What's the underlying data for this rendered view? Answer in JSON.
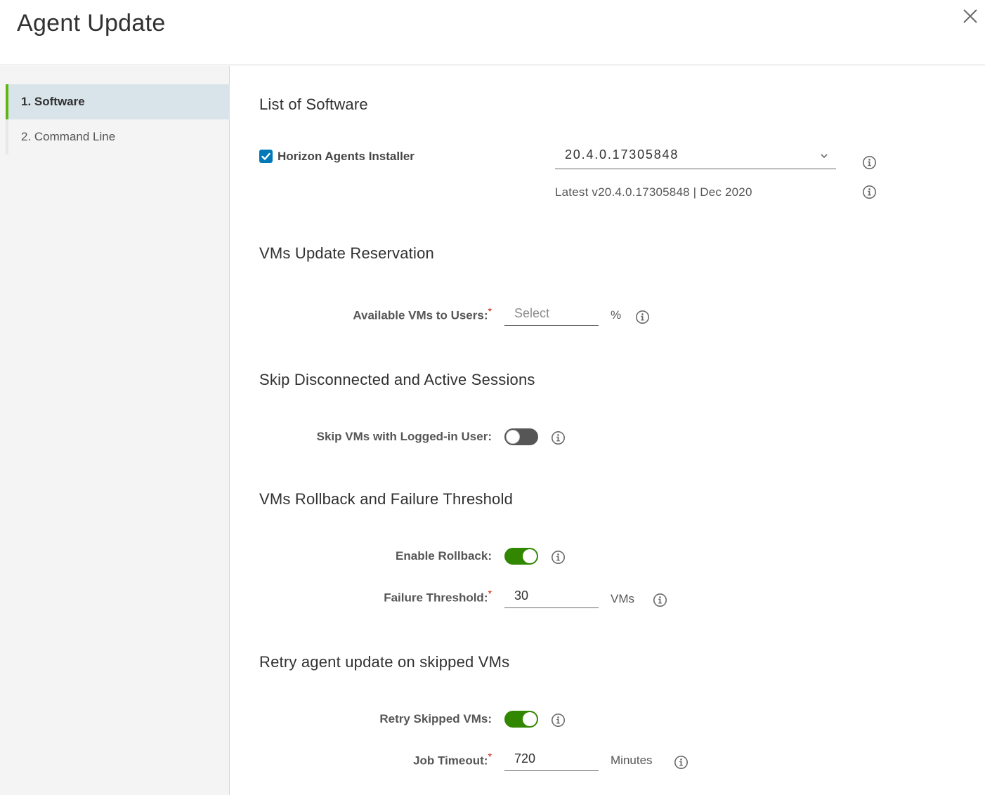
{
  "dialog": {
    "title": "Agent Update",
    "close_icon": "close-icon"
  },
  "steps": [
    {
      "label": "1. Software",
      "active": true
    },
    {
      "label": "2. Command Line",
      "active": false
    }
  ],
  "sections": {
    "software": {
      "title": "List of Software",
      "installer_label": "Horizon Agents Installer",
      "installer_checked": true,
      "version_selected": "20.4.0.17305848",
      "latest_text": "Latest v20.4.0.17305848 | Dec 2020"
    },
    "reservation": {
      "title": "VMs Update Reservation",
      "available_label": "Available VMs to Users:",
      "available_required": "*",
      "available_placeholder": "Select",
      "available_value": "",
      "available_unit": "%"
    },
    "skip": {
      "title": "Skip Disconnected and Active Sessions",
      "skip_label": "Skip VMs with Logged-in User:",
      "skip_enabled": false
    },
    "rollback": {
      "title": "VMs Rollback and Failure Threshold",
      "rollback_label": "Enable Rollback:",
      "rollback_enabled": true,
      "threshold_label": "Failure Threshold:",
      "threshold_required": "*",
      "threshold_value": "30",
      "threshold_unit": "VMs"
    },
    "retry": {
      "title": "Retry agent update on skipped VMs",
      "retry_label": "Retry Skipped VMs:",
      "retry_enabled": true,
      "timeout_label": "Job Timeout:",
      "timeout_required": "*",
      "timeout_value": "720",
      "timeout_unit": "Minutes"
    }
  },
  "colors": {
    "accent": "#0079b8",
    "active_step_bar": "#60b515",
    "toggle_on": "#318700",
    "toggle_off": "#565656",
    "required": "#c92100"
  }
}
